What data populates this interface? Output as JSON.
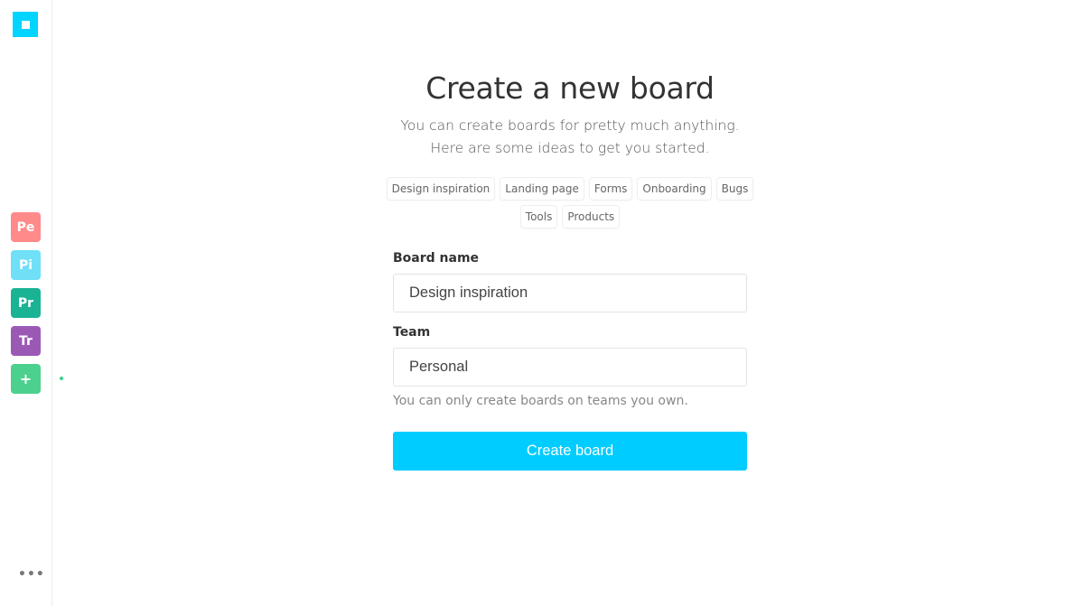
{
  "sidebar": {
    "logo_icon": "square-logo-icon",
    "teams": [
      {
        "label": "Pe",
        "color": "#ff8a8a"
      },
      {
        "label": "Pi",
        "color": "#6fe0f8"
      },
      {
        "label": "Pr",
        "color": "#1ab394"
      },
      {
        "label": "Tr",
        "color": "#9b59b6"
      }
    ],
    "add_team": {
      "label": "+",
      "color": "#4cd08e"
    },
    "more_label": "•••"
  },
  "main": {
    "title": "Create a new board",
    "subtitle_line1": "You can create boards for pretty much anything.",
    "subtitle_line2": "Here are some ideas to get you started.",
    "tags_row1": [
      "Design inspiration",
      "Landing page",
      "Forms",
      "Onboarding",
      "Bugs"
    ],
    "tags_row2": [
      "Tools",
      "Products"
    ],
    "board_name": {
      "label": "Board name",
      "value": "Design inspiration"
    },
    "team": {
      "label": "Team",
      "value": "Personal"
    },
    "helper_text": "You can only create boards on teams you own.",
    "create_button": "Create board",
    "accent_color": "#00ccff"
  }
}
